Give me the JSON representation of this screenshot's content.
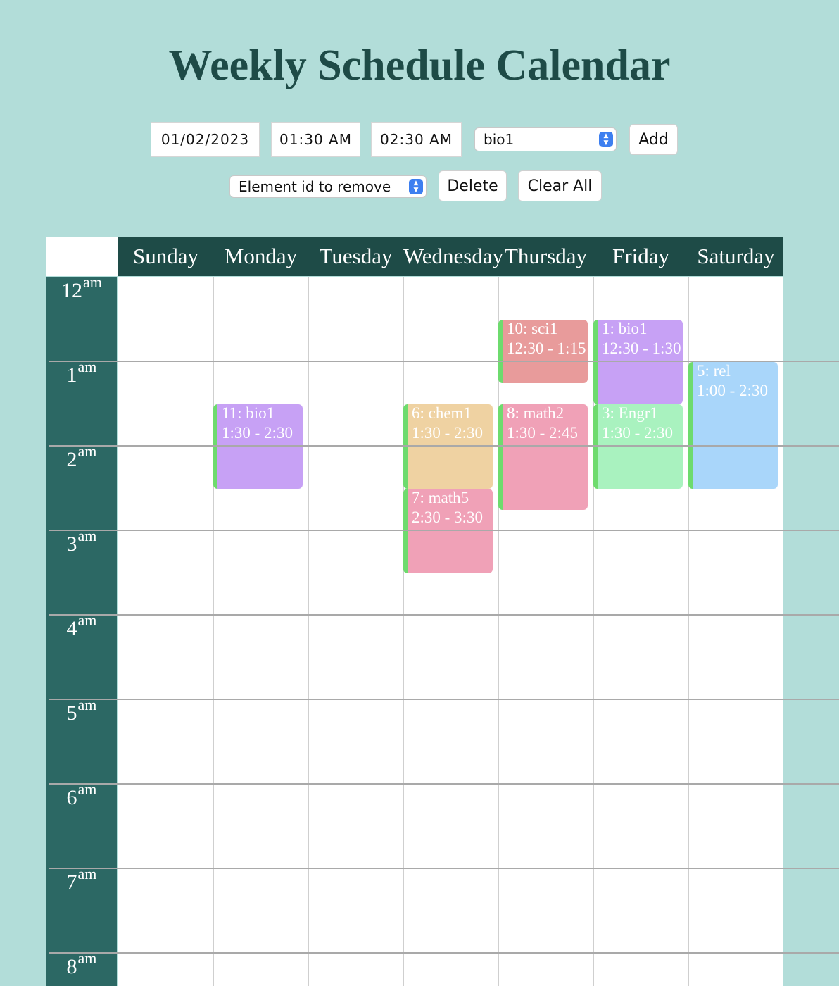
{
  "title": "Weekly Schedule Calendar",
  "controls": {
    "date": "01/02/2023",
    "start_time": "01:30 AM",
    "end_time": "02:30 AM",
    "course_select": "bio1",
    "add_label": "Add",
    "remove_select": "Element id to remove",
    "delete_label": "Delete",
    "clear_label": "Clear All"
  },
  "days": [
    "Sunday",
    "Monday",
    "Tuesday",
    "Wednesday",
    "Thursday",
    "Friday",
    "Saturday"
  ],
  "hours": [
    {
      "num": "12",
      "suffix": "am"
    },
    {
      "num": "1",
      "suffix": "am"
    },
    {
      "num": "2",
      "suffix": "am"
    },
    {
      "num": "3",
      "suffix": "am"
    },
    {
      "num": "4",
      "suffix": "am"
    },
    {
      "num": "5",
      "suffix": "am"
    },
    {
      "num": "6",
      "suffix": "am"
    },
    {
      "num": "7",
      "suffix": "am"
    },
    {
      "num": "8",
      "suffix": "am"
    }
  ],
  "events": [
    {
      "label": "10: sci1",
      "time": "12:30 - 1:15",
      "day": 4,
      "start": 0.5,
      "end": 1.25,
      "color": "#e89b9b"
    },
    {
      "label": "1: bio1",
      "time": "12:30 - 1:30",
      "day": 5,
      "start": 0.5,
      "end": 1.5,
      "color": "#c7a1f5"
    },
    {
      "label": "5: rel",
      "time": "1:00 - 2:30",
      "day": 6,
      "start": 1.0,
      "end": 2.5,
      "color": "#a9d6fa"
    },
    {
      "label": "11: bio1",
      "time": "1:30 - 2:30",
      "day": 1,
      "start": 1.5,
      "end": 2.5,
      "color": "#c7a1f5"
    },
    {
      "label": "6: chem1",
      "time": "1:30 - 2:30",
      "day": 3,
      "start": 1.5,
      "end": 2.5,
      "color": "#efd2a2"
    },
    {
      "label": "8: math2",
      "time": "1:30 - 2:45",
      "day": 4,
      "start": 1.5,
      "end": 2.75,
      "color": "#f0a1b7"
    },
    {
      "label": "3: Engr1",
      "time": "1:30 - 2:30",
      "day": 5,
      "start": 1.5,
      "end": 2.5,
      "color": "#a9f2bf"
    },
    {
      "label": "7: math5",
      "time": "2:30 - 3:30",
      "day": 3,
      "start": 2.5,
      "end": 3.5,
      "color": "#f0a1b7"
    }
  ]
}
